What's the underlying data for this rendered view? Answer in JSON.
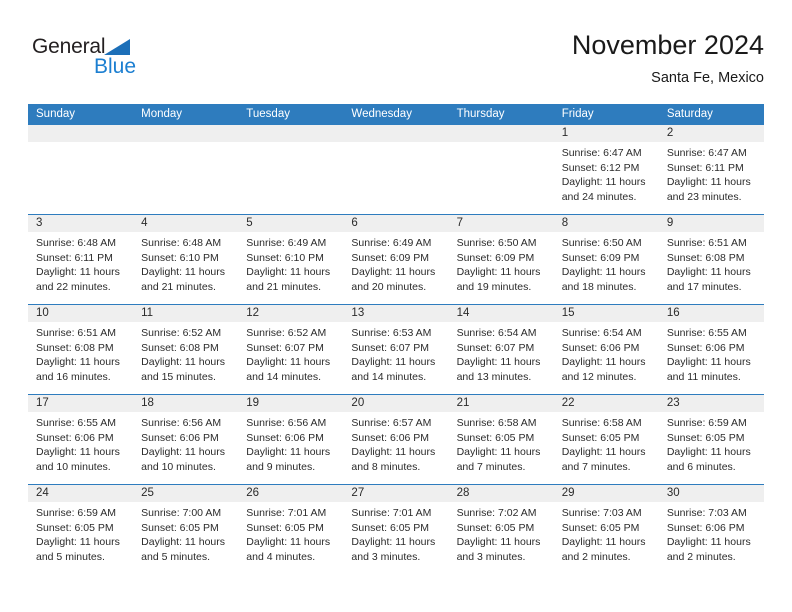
{
  "brand": {
    "name_part1": "General",
    "name_part2": "Blue",
    "triangle_icon": "triangle-icon",
    "accent_color": "#1c7fd1"
  },
  "header": {
    "title": "November 2024",
    "subtitle": "Santa Fe, Mexico"
  },
  "theme": {
    "header_bar_color": "#2e7cbe",
    "day_band_color": "#efefef",
    "text_color": "#2b2b2b"
  },
  "calendar": {
    "weekdays": [
      "Sunday",
      "Monday",
      "Tuesday",
      "Wednesday",
      "Thursday",
      "Friday",
      "Saturday"
    ],
    "weeks": [
      [
        {
          "day": "",
          "lines": []
        },
        {
          "day": "",
          "lines": []
        },
        {
          "day": "",
          "lines": []
        },
        {
          "day": "",
          "lines": []
        },
        {
          "day": "",
          "lines": []
        },
        {
          "day": "1",
          "lines": [
            "Sunrise: 6:47 AM",
            "Sunset: 6:12 PM",
            "Daylight: 11 hours",
            "and 24 minutes."
          ]
        },
        {
          "day": "2",
          "lines": [
            "Sunrise: 6:47 AM",
            "Sunset: 6:11 PM",
            "Daylight: 11 hours",
            "and 23 minutes."
          ]
        }
      ],
      [
        {
          "day": "3",
          "lines": [
            "Sunrise: 6:48 AM",
            "Sunset: 6:11 PM",
            "Daylight: 11 hours",
            "and 22 minutes."
          ]
        },
        {
          "day": "4",
          "lines": [
            "Sunrise: 6:48 AM",
            "Sunset: 6:10 PM",
            "Daylight: 11 hours",
            "and 21 minutes."
          ]
        },
        {
          "day": "5",
          "lines": [
            "Sunrise: 6:49 AM",
            "Sunset: 6:10 PM",
            "Daylight: 11 hours",
            "and 21 minutes."
          ]
        },
        {
          "day": "6",
          "lines": [
            "Sunrise: 6:49 AM",
            "Sunset: 6:09 PM",
            "Daylight: 11 hours",
            "and 20 minutes."
          ]
        },
        {
          "day": "7",
          "lines": [
            "Sunrise: 6:50 AM",
            "Sunset: 6:09 PM",
            "Daylight: 11 hours",
            "and 19 minutes."
          ]
        },
        {
          "day": "8",
          "lines": [
            "Sunrise: 6:50 AM",
            "Sunset: 6:09 PM",
            "Daylight: 11 hours",
            "and 18 minutes."
          ]
        },
        {
          "day": "9",
          "lines": [
            "Sunrise: 6:51 AM",
            "Sunset: 6:08 PM",
            "Daylight: 11 hours",
            "and 17 minutes."
          ]
        }
      ],
      [
        {
          "day": "10",
          "lines": [
            "Sunrise: 6:51 AM",
            "Sunset: 6:08 PM",
            "Daylight: 11 hours",
            "and 16 minutes."
          ]
        },
        {
          "day": "11",
          "lines": [
            "Sunrise: 6:52 AM",
            "Sunset: 6:08 PM",
            "Daylight: 11 hours",
            "and 15 minutes."
          ]
        },
        {
          "day": "12",
          "lines": [
            "Sunrise: 6:52 AM",
            "Sunset: 6:07 PM",
            "Daylight: 11 hours",
            "and 14 minutes."
          ]
        },
        {
          "day": "13",
          "lines": [
            "Sunrise: 6:53 AM",
            "Sunset: 6:07 PM",
            "Daylight: 11 hours",
            "and 14 minutes."
          ]
        },
        {
          "day": "14",
          "lines": [
            "Sunrise: 6:54 AM",
            "Sunset: 6:07 PM",
            "Daylight: 11 hours",
            "and 13 minutes."
          ]
        },
        {
          "day": "15",
          "lines": [
            "Sunrise: 6:54 AM",
            "Sunset: 6:06 PM",
            "Daylight: 11 hours",
            "and 12 minutes."
          ]
        },
        {
          "day": "16",
          "lines": [
            "Sunrise: 6:55 AM",
            "Sunset: 6:06 PM",
            "Daylight: 11 hours",
            "and 11 minutes."
          ]
        }
      ],
      [
        {
          "day": "17",
          "lines": [
            "Sunrise: 6:55 AM",
            "Sunset: 6:06 PM",
            "Daylight: 11 hours",
            "and 10 minutes."
          ]
        },
        {
          "day": "18",
          "lines": [
            "Sunrise: 6:56 AM",
            "Sunset: 6:06 PM",
            "Daylight: 11 hours",
            "and 10 minutes."
          ]
        },
        {
          "day": "19",
          "lines": [
            "Sunrise: 6:56 AM",
            "Sunset: 6:06 PM",
            "Daylight: 11 hours",
            "and 9 minutes."
          ]
        },
        {
          "day": "20",
          "lines": [
            "Sunrise: 6:57 AM",
            "Sunset: 6:06 PM",
            "Daylight: 11 hours",
            "and 8 minutes."
          ]
        },
        {
          "day": "21",
          "lines": [
            "Sunrise: 6:58 AM",
            "Sunset: 6:05 PM",
            "Daylight: 11 hours",
            "and 7 minutes."
          ]
        },
        {
          "day": "22",
          "lines": [
            "Sunrise: 6:58 AM",
            "Sunset: 6:05 PM",
            "Daylight: 11 hours",
            "and 7 minutes."
          ]
        },
        {
          "day": "23",
          "lines": [
            "Sunrise: 6:59 AM",
            "Sunset: 6:05 PM",
            "Daylight: 11 hours",
            "and 6 minutes."
          ]
        }
      ],
      [
        {
          "day": "24",
          "lines": [
            "Sunrise: 6:59 AM",
            "Sunset: 6:05 PM",
            "Daylight: 11 hours",
            "and 5 minutes."
          ]
        },
        {
          "day": "25",
          "lines": [
            "Sunrise: 7:00 AM",
            "Sunset: 6:05 PM",
            "Daylight: 11 hours",
            "and 5 minutes."
          ]
        },
        {
          "day": "26",
          "lines": [
            "Sunrise: 7:01 AM",
            "Sunset: 6:05 PM",
            "Daylight: 11 hours",
            "and 4 minutes."
          ]
        },
        {
          "day": "27",
          "lines": [
            "Sunrise: 7:01 AM",
            "Sunset: 6:05 PM",
            "Daylight: 11 hours",
            "and 3 minutes."
          ]
        },
        {
          "day": "28",
          "lines": [
            "Sunrise: 7:02 AM",
            "Sunset: 6:05 PM",
            "Daylight: 11 hours",
            "and 3 minutes."
          ]
        },
        {
          "day": "29",
          "lines": [
            "Sunrise: 7:03 AM",
            "Sunset: 6:05 PM",
            "Daylight: 11 hours",
            "and 2 minutes."
          ]
        },
        {
          "day": "30",
          "lines": [
            "Sunrise: 7:03 AM",
            "Sunset: 6:06 PM",
            "Daylight: 11 hours",
            "and 2 minutes."
          ]
        }
      ]
    ]
  }
}
